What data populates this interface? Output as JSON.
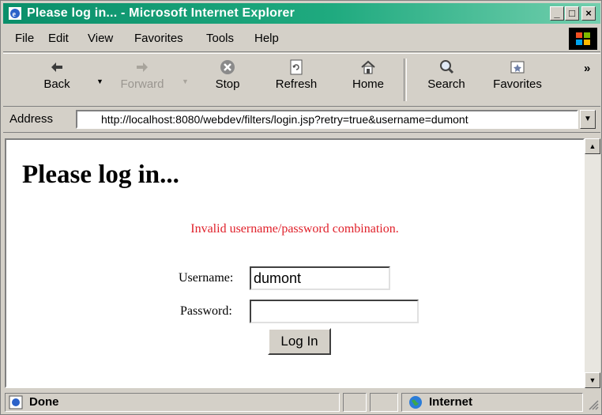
{
  "window": {
    "title": "Please log in... - Microsoft Internet Explorer",
    "controls": {
      "minimize": "_",
      "maximize": "□",
      "close": "×"
    }
  },
  "menubar": {
    "items": [
      {
        "label": "File",
        "accel": "F"
      },
      {
        "label": "Edit",
        "accel": "E"
      },
      {
        "label": "View",
        "accel": "V"
      },
      {
        "label": "Favorites",
        "accel": "a"
      },
      {
        "label": "Tools",
        "accel": "T"
      },
      {
        "label": "Help",
        "accel": "H"
      }
    ]
  },
  "toolbar": {
    "back": "Back",
    "forward": "Forward",
    "stop": "Stop",
    "refresh": "Refresh",
    "home": "Home",
    "search": "Search",
    "favorites": "Favorites",
    "more": "»"
  },
  "address": {
    "label": "Address",
    "url": "http://localhost:8080/webdev/filters/login.jsp?retry=true&username=dumont"
  },
  "page": {
    "heading": "Please log in...",
    "error": "Invalid username/password combination.",
    "username_label": "Username:",
    "username_value": "dumont",
    "password_label": "Password:",
    "password_value": "",
    "login_button": "Log In"
  },
  "status": {
    "text": "Done",
    "zone": "Internet"
  },
  "colors": {
    "titlebar": "#1faa7f",
    "error": "#e0202a",
    "chrome": "#d4d0c8"
  }
}
